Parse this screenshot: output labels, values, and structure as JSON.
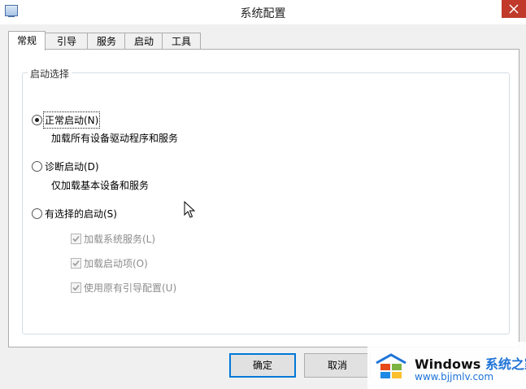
{
  "window": {
    "title": "系统配置"
  },
  "tabs": [
    {
      "label": "常规",
      "active": true
    },
    {
      "label": "引导",
      "active": false
    },
    {
      "label": "服务",
      "active": false
    },
    {
      "label": "启动",
      "active": false
    },
    {
      "label": "工具",
      "active": false
    }
  ],
  "startup": {
    "legend": "启动选择",
    "normal": {
      "label": "正常启动(N)",
      "description": "加载所有设备驱动程序和服务",
      "selected": true
    },
    "diagnostic": {
      "label": "诊断启动(D)",
      "description": "仅加载基本设备和服务",
      "selected": false
    },
    "selective": {
      "label": "有选择的启动(S)",
      "selected": false
    },
    "options": [
      {
        "label": "加载系统服务(L)",
        "checked": true
      },
      {
        "label": "加载启动项(O)",
        "checked": true
      },
      {
        "label": "使用原有引导配置(U)",
        "checked": true
      }
    ]
  },
  "buttons": {
    "ok": "确定",
    "cancel": "取消"
  },
  "watermark": {
    "brand": "Windows",
    "cn": "系统之家",
    "url": "www.bjjmlv.com"
  },
  "colors": {
    "close": "#c0392b",
    "accent": "#0078d7"
  }
}
